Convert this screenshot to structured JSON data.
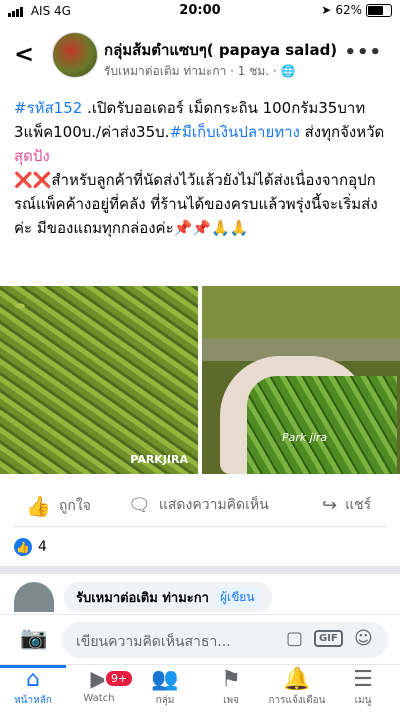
{
  "status_bar": {
    "carrier": "AIS",
    "network": "4G",
    "time": "20:00",
    "battery": "62%"
  },
  "header": {
    "group_name": "กลุ่มส้มตำแซบๆ( papaya salad)",
    "author_meta": "รับเหมาต่อเติม ท่ามะกา · 1 ชม. · 🌐"
  },
  "post": {
    "tag1": "#รหัส152",
    "line1": " .เปิดรับออเดอร์ เม็ดกระถิน 100กรัม35บาท 3แพ็ค100บ./ค่าส่ง35บ.",
    "tag2": "#มีเก็บเงินปลายทาง",
    "line2": " ส่งทุกจังหวัด",
    "tag3": "สุดปัง",
    "warn_icon": "❌❌",
    "line3": "สำหรับลูกค้าที่นัดส่งไว้แล้วยังไม่ได้ส่งเนื่องจากอุปกรณ์แพ็คค้างอยู่ที่คลัง ที่ร้านได้ของครบแล้วพรุ่งนี้จะเริ่มส่งค่ะ มีของแถมทุกกล่องค่ะ📌📌🙏🙏"
  },
  "photos": {
    "watermark1": "PARKJIRA",
    "watermark2": "Park jira"
  },
  "actions": {
    "like": "ถูกใจ",
    "comment": "แสดงความคิดเห็น",
    "share": "แชร์"
  },
  "reactions": {
    "count": "4"
  },
  "comment": {
    "author": "รับเหมาต่อเติม ท่ามะกา",
    "badge": "ผู้เขียน"
  },
  "composer": {
    "placeholder": "เขียนความคิดเห็นสาธา...",
    "gif": "GIF"
  },
  "tabs": [
    {
      "label": "หน้าหลัก",
      "icon": "home-icon"
    },
    {
      "label": "Watch",
      "icon": "watch-icon",
      "badge": "9+"
    },
    {
      "label": "กลุ่ม",
      "icon": "groups-icon"
    },
    {
      "label": "เพจ",
      "icon": "flag-icon"
    },
    {
      "label": "การแจ้งเตือน",
      "icon": "bell-icon"
    },
    {
      "label": "เมนู",
      "icon": "menu-icon"
    }
  ],
  "colors": {
    "accent": "#1877f2",
    "warn": "#e41e3f"
  }
}
